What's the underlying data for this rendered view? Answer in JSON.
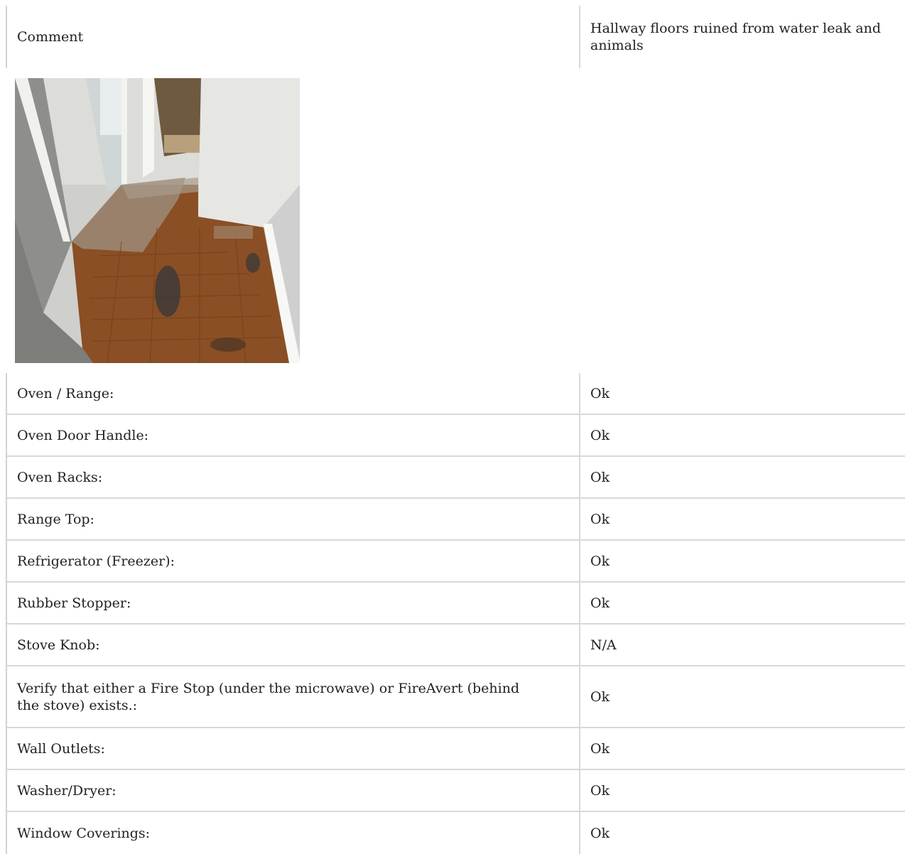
{
  "comment_row": {
    "label": "Comment",
    "value": "Hallway floors ruined from water leak and animals"
  },
  "photo": {
    "description": "Hallway with damaged hardwood floor",
    "colors": {
      "floor": "#8a4f24",
      "wall": "#d9d9d6",
      "door_trim": "#f2f2ef",
      "stain": "#3d3a38"
    }
  },
  "items": [
    {
      "label": "Oven / Range:",
      "value": "Ok"
    },
    {
      "label": "Oven Door Handle:",
      "value": "Ok"
    },
    {
      "label": "Oven Racks:",
      "value": "Ok"
    },
    {
      "label": "Range Top:",
      "value": "Ok"
    },
    {
      "label": "Refrigerator (Freezer):",
      "value": "Ok"
    },
    {
      "label": "Rubber Stopper:",
      "value": "Ok"
    },
    {
      "label": "Stove Knob:",
      "value": "N/A"
    },
    {
      "label": "Verify that either a Fire Stop (under the microwave) or FireAvert (behind the stove) exists.:",
      "value": "Ok"
    },
    {
      "label": "Wall Outlets:",
      "value": "Ok"
    },
    {
      "label": "Washer/Dryer:",
      "value": "Ok"
    },
    {
      "label": "Window Coverings:",
      "value": "Ok"
    }
  ]
}
